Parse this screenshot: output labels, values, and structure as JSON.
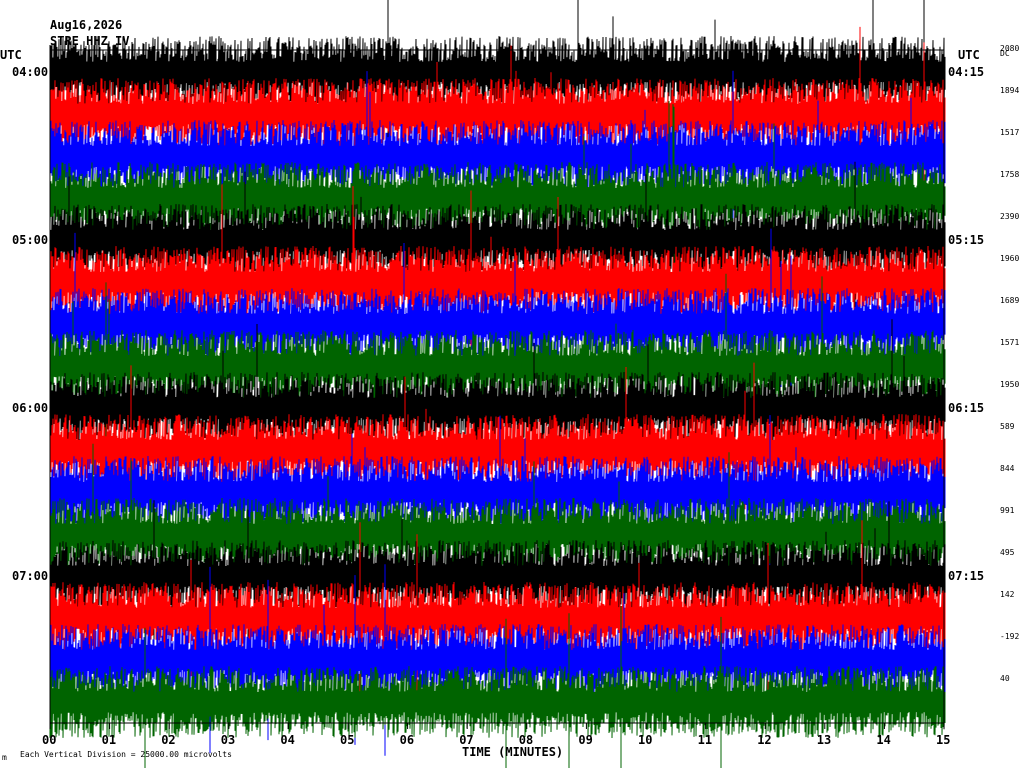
{
  "header": {
    "date": "Aug16,2026",
    "station": "STRE HHZ IV",
    "utc_left": "UTC",
    "utc_right": "UTC",
    "dc_label": "DC"
  },
  "footer": {
    "scale_note": "Each Vertical Division = 25000.00 microvolts",
    "corner_mark": "m"
  },
  "chart_data": {
    "type": "line",
    "title": "",
    "xlabel": "TIME (MINUTES)",
    "ylabel": "",
    "xlim": [
      0,
      15
    ],
    "x_ticks": [
      "00",
      "01",
      "02",
      "03",
      "04",
      "05",
      "06",
      "07",
      "08",
      "09",
      "10",
      "11",
      "12",
      "13",
      "14",
      "15"
    ],
    "left_time_labels": [
      "04:00",
      "05:00",
      "06:00",
      "07:00"
    ],
    "right_time_labels": [
      "04:15",
      "05:15",
      "06:15",
      "07:15"
    ],
    "trace_colors": [
      "#000000",
      "#ff0000",
      "#0000ff",
      "#006400"
    ],
    "dc_offsets": [
      2080,
      1894,
      1517,
      1758,
      2390,
      1960,
      1689,
      1571,
      1950,
      589,
      844,
      991,
      495,
      142,
      -192,
      40
    ]
  }
}
